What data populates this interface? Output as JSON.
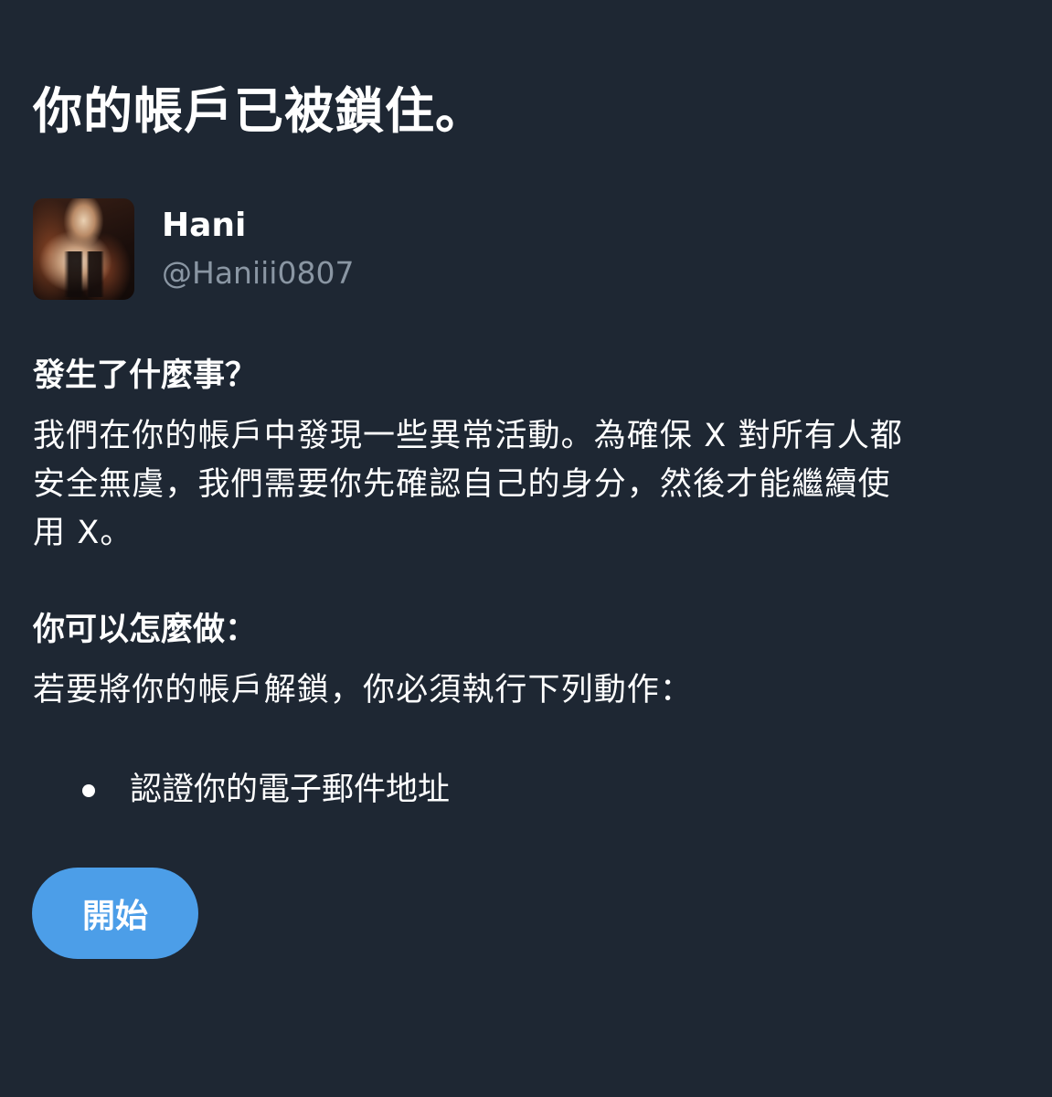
{
  "page": {
    "title": "你的帳戶已被鎖住。"
  },
  "account": {
    "display_name": "Hani",
    "handle": "@Haniii0807",
    "avatar": "profile photo"
  },
  "what_happened": {
    "heading": "發生了什麼事？",
    "lines": [
      "我們在你的帳戶中發現一些異常活動。為確保 X 對所有人都",
      "安全無虞，我們需要你先確認自己的身分，然後才能繼續使",
      "用 X。"
    ]
  },
  "what_to_do": {
    "heading": "你可以怎麼做：",
    "intro": "若要將你的帳戶解鎖，你必須執行下列動作：",
    "steps": [
      "認證你的電子郵件地址"
    ]
  },
  "actions": {
    "start_label": "開始",
    "start_color": "#4c9ee8"
  },
  "colors": {
    "background": "#1e2733",
    "text": "#ffffff",
    "secondary_text": "#8a96a3"
  }
}
